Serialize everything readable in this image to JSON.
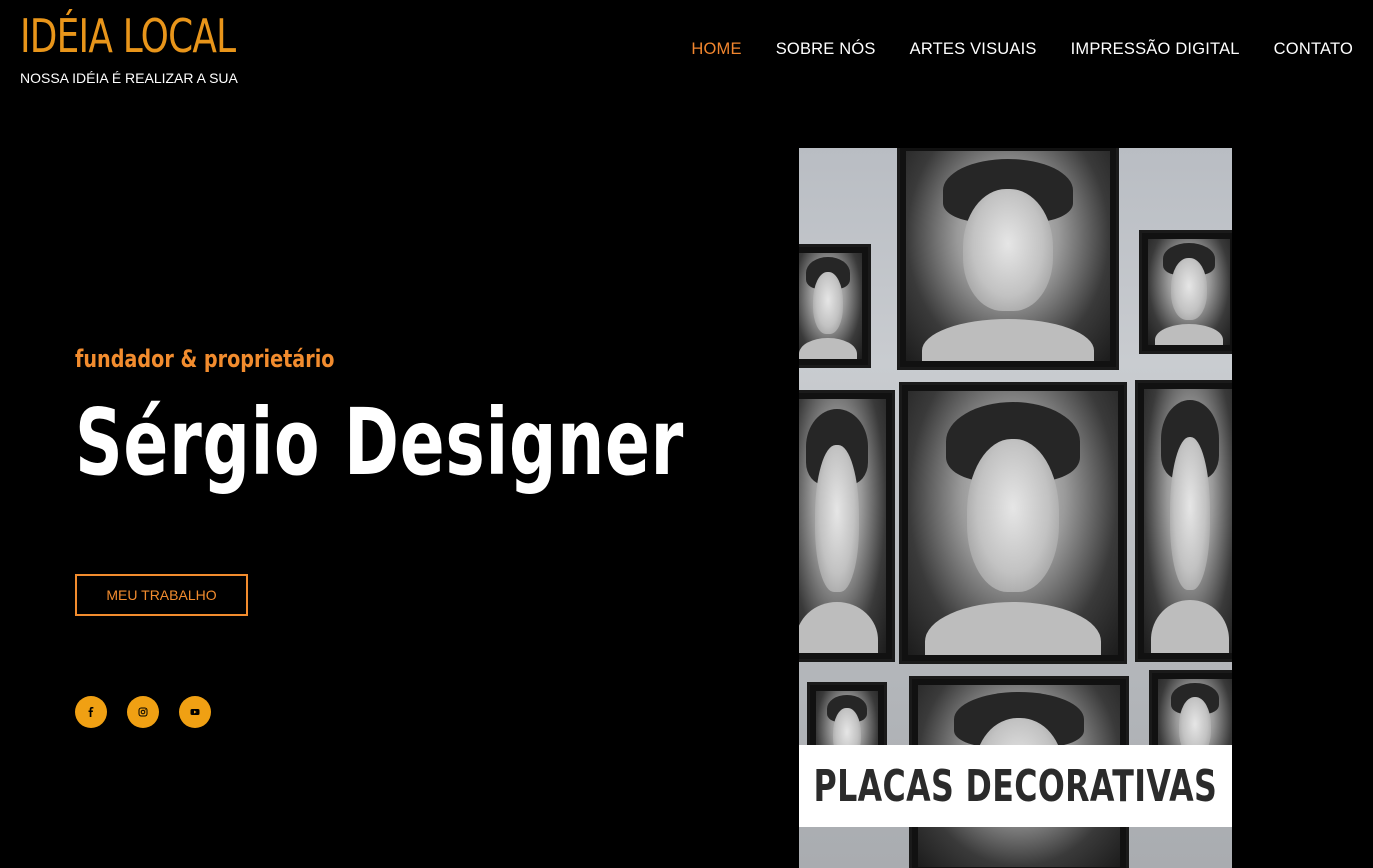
{
  "brand": {
    "title": "IDÉIA LOCAL",
    "tagline": "NOSSA IDÉIA É REALIZAR A SUA"
  },
  "nav": {
    "items": [
      {
        "label": "HOME",
        "active": true
      },
      {
        "label": "SOBRE NÓS",
        "active": false
      },
      {
        "label": "ARTES VISUAIS",
        "active": false
      },
      {
        "label": "IMPRESSÃO DIGITAL",
        "active": false
      },
      {
        "label": "CONTATO",
        "active": false
      }
    ]
  },
  "hero": {
    "subtitle": "fundador & proprietário",
    "headline": "Sérgio Designer",
    "cta_label": "MEU TRABALHO"
  },
  "social": {
    "items": [
      {
        "icon": "facebook-icon"
      },
      {
        "icon": "instagram-icon"
      },
      {
        "icon": "youtube-icon"
      }
    ]
  },
  "gallery": {
    "banner_text": "PLACAS DECORATIVAS"
  },
  "colors": {
    "accent": "#f28c2e",
    "brand": "#e8951a",
    "social_bg": "#f0a013",
    "background": "#000000"
  }
}
